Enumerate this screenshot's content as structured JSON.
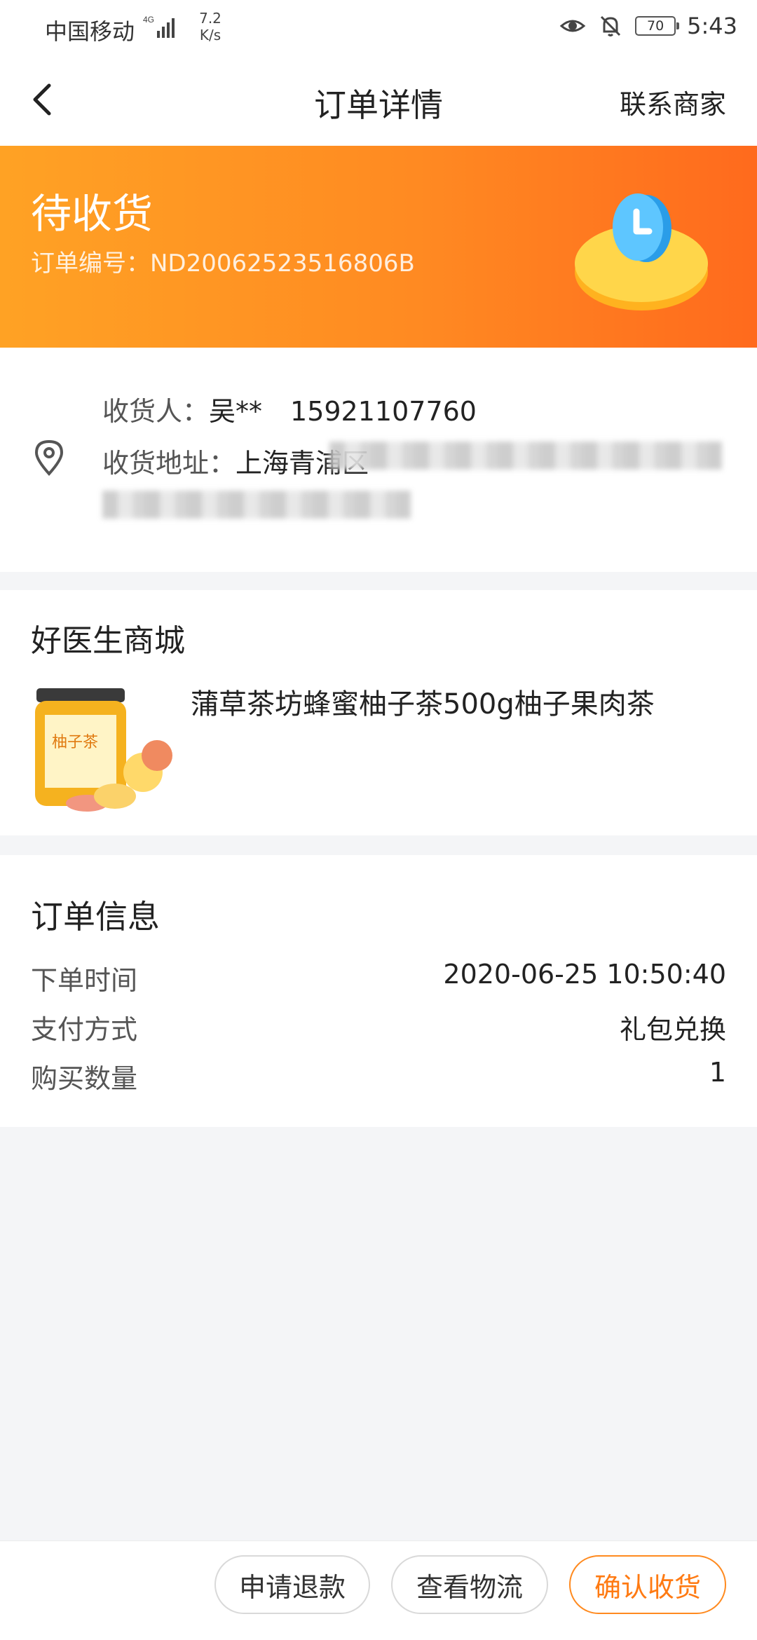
{
  "status_bar": {
    "carrier": "中国移动",
    "network": "4G",
    "speed_value": "7.2",
    "speed_unit": "K/s",
    "battery": "70",
    "time": "5:43",
    "icons": [
      "signal-icon",
      "eye-icon",
      "bell-off-icon",
      "battery-icon"
    ]
  },
  "nav": {
    "back_icon": "chevron-left-icon",
    "title": "订单详情",
    "contact": "联系商家"
  },
  "banner": {
    "status": "待收货",
    "order_label": "订单编号：",
    "order_number": "ND20062523516806B",
    "illustration_icon": "clock-icon",
    "colors": {
      "start": "#ffa224",
      "end": "#ff6a1d"
    }
  },
  "address": {
    "icon": "location-pin-icon",
    "recipient_label": "收货人：",
    "recipient_name": "吴**",
    "phone": "15921107760",
    "address_label": "收货地址：",
    "address_visible": "上海青浦区"
  },
  "store": {
    "name": "好医生商城",
    "product": {
      "title": "蒲草茶坊蜂蜜柚子茶500g柚子果肉茶",
      "jar_text": "柚子茶"
    }
  },
  "order_info": {
    "title": "订单信息",
    "rows": [
      {
        "label": "下单时间",
        "value": "2020-06-25 10:50:40"
      },
      {
        "label": "支付方式",
        "value": "礼包兑换"
      },
      {
        "label": "购买数量",
        "value": "1"
      }
    ]
  },
  "actions": {
    "refund": "申请退款",
    "logistics": "查看物流",
    "confirm": "确认收货",
    "accent_color": "#ff7a12"
  }
}
